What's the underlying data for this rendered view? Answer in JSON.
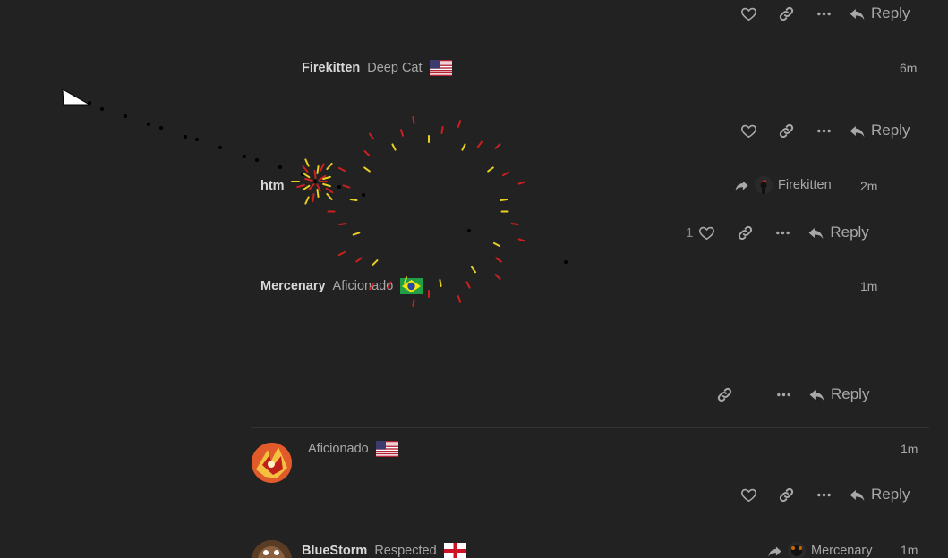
{
  "posts": [
    {
      "username": "",
      "title": "",
      "time": "",
      "actions": {
        "reply_label": "Reply"
      }
    },
    {
      "username": "Firekitten",
      "title": "Deep Cat",
      "flag": "us",
      "time": "6m",
      "actions": {
        "reply_label": "Reply"
      }
    },
    {
      "username": "htm",
      "title": "",
      "reply_to": "Firekitten",
      "time": "2m",
      "actions": {
        "like_count": "1",
        "reply_label": "Reply"
      }
    },
    {
      "username": "Mercenary",
      "title": "Aficionado",
      "flag": "br",
      "time": "1m",
      "actions": {
        "reply_label": "Reply"
      }
    },
    {
      "username": "",
      "title": "Aficionado",
      "flag": "us",
      "time": "1m",
      "actions": {
        "reply_label": "Reply"
      }
    },
    {
      "username": "BlueStorm",
      "title": "Respected",
      "flag": "england",
      "reply_to": "Mercenary",
      "time": "1m"
    }
  ],
  "colors": {
    "background": "#222222",
    "text_muted": "#a8a8a8",
    "firework_yellow": "#e8d020",
    "firework_red": "#cc2020"
  },
  "icons": {
    "like": "heart-icon",
    "link": "link-icon",
    "more": "ellipsis-icon",
    "reply": "reply-arrow-icon",
    "cursor": "pointer-cursor-icon"
  }
}
